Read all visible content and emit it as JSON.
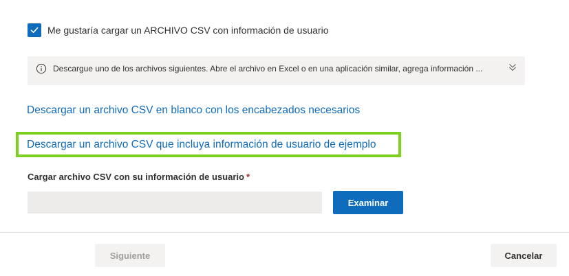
{
  "csv_option": {
    "checked": true,
    "label": "Me gustaría cargar un ARCHIVO CSV con información de usuario",
    "checkmark_icon": "checkmark-icon"
  },
  "info_bar": {
    "icon": "info-icon",
    "text": "Descargue uno de los archivos siguientes. Abre el archivo en Excel o en una aplicación similar, agrega información ...",
    "expand_icon": "double-chevron-down-icon"
  },
  "links": {
    "blank_csv": "Descargar un archivo CSV en blanco con los encabezados necesarios",
    "sample_csv": "Descargar un archivo CSV que incluya información de usuario de ejemplo"
  },
  "upload": {
    "label": "Cargar archivo CSV con su información de usuario",
    "required_marker": "*",
    "value": "",
    "browse_label": "Examinar"
  },
  "footer": {
    "next_label": "Siguiente",
    "next_disabled": true,
    "cancel_label": "Cancelar"
  },
  "colors": {
    "accent": "#0f6cbd",
    "highlight": "#7dd11e",
    "info_bar_bg": "#f3f2f1"
  }
}
